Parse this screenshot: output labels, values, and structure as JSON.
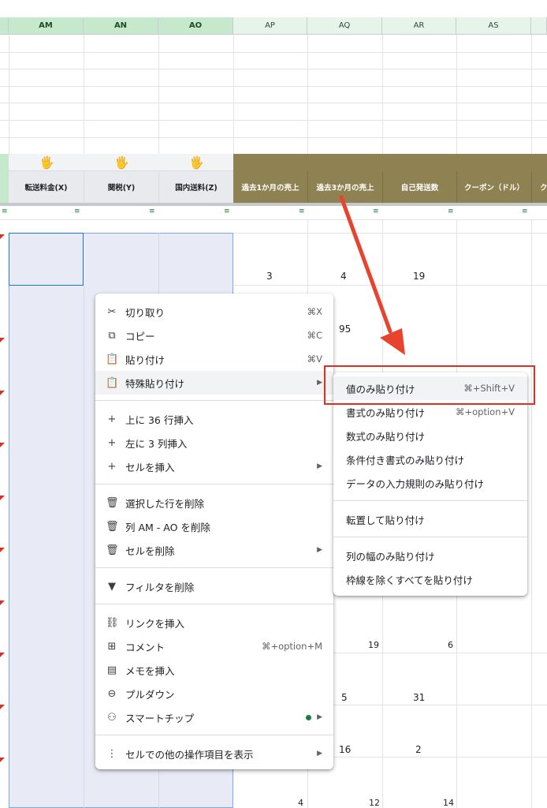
{
  "columns": [
    {
      "id": "AM",
      "selected": true
    },
    {
      "id": "AN",
      "selected": true
    },
    {
      "id": "AO",
      "selected": true
    },
    {
      "id": "AP",
      "selected": false
    },
    {
      "id": "AQ",
      "selected": false
    },
    {
      "id": "AR",
      "selected": false
    },
    {
      "id": "AS",
      "selected": false
    }
  ],
  "header_row": {
    "hand_icon": "raised-hand-icon",
    "labels": [
      "転送料金(X)",
      "関税(Y)",
      "国内送料(Z)",
      "過去1か月の売上",
      "過去3か月の売上",
      "自己発送数",
      "クーポン（ドル）",
      "ク"
    ]
  },
  "cell_values": {
    "r1": [
      "3",
      "4",
      "19"
    ],
    "r2_aq": "95",
    "r3": [
      "19",
      "6"
    ],
    "r4": [
      "5",
      "31"
    ],
    "r5": [
      "16",
      "2"
    ],
    "r6": [
      "4",
      "12",
      "14"
    ]
  },
  "context_menu": {
    "cut": {
      "label": "切り取り",
      "shortcut": "⌘X"
    },
    "copy": {
      "label": "コピー",
      "shortcut": "⌘C"
    },
    "paste": {
      "label": "貼り付け",
      "shortcut": "⌘V"
    },
    "paste_special": {
      "label": "特殊貼り付け"
    },
    "insert_rows": {
      "label": "上に 36 行挿入"
    },
    "insert_cols": {
      "label": "左に 3 列挿入"
    },
    "insert_cells": {
      "label": "セルを挿入"
    },
    "delete_rows": {
      "label": "選択した行を削除"
    },
    "delete_cols": {
      "label": "列 AM - AO を削除"
    },
    "delete_cells": {
      "label": "セルを削除"
    },
    "remove_filter": {
      "label": "フィルタを削除"
    },
    "insert_link": {
      "label": "リンクを挿入"
    },
    "comment": {
      "label": "コメント",
      "shortcut": "⌘+option+M"
    },
    "insert_note": {
      "label": "メモを挿入"
    },
    "dropdown": {
      "label": "プルダウン"
    },
    "smart_chips": {
      "label": "スマートチップ"
    },
    "more_actions": {
      "label": "セルでの他の操作項目を表示"
    }
  },
  "submenu": {
    "values_only": {
      "label": "値のみ貼り付け",
      "shortcut": "⌘+Shift+V"
    },
    "format_only": {
      "label": "書式のみ貼り付け",
      "shortcut": "⌘+option+V"
    },
    "formula_only": {
      "label": "数式のみ貼り付け"
    },
    "cond_format_only": {
      "label": "条件付き書式のみ貼り付け"
    },
    "validation_only": {
      "label": "データの入力規則のみ貼り付け"
    },
    "transpose": {
      "label": "転置して貼り付け"
    },
    "col_width_only": {
      "label": "列の幅のみ貼り付け"
    },
    "all_except_borders": {
      "label": "枠線を除くすべてを貼り付け"
    }
  },
  "colors": {
    "accent_header": "#8e8152",
    "selection": "#e8eaf6",
    "annotation": "#e8432d",
    "highlight_box": "#e02f1f"
  }
}
